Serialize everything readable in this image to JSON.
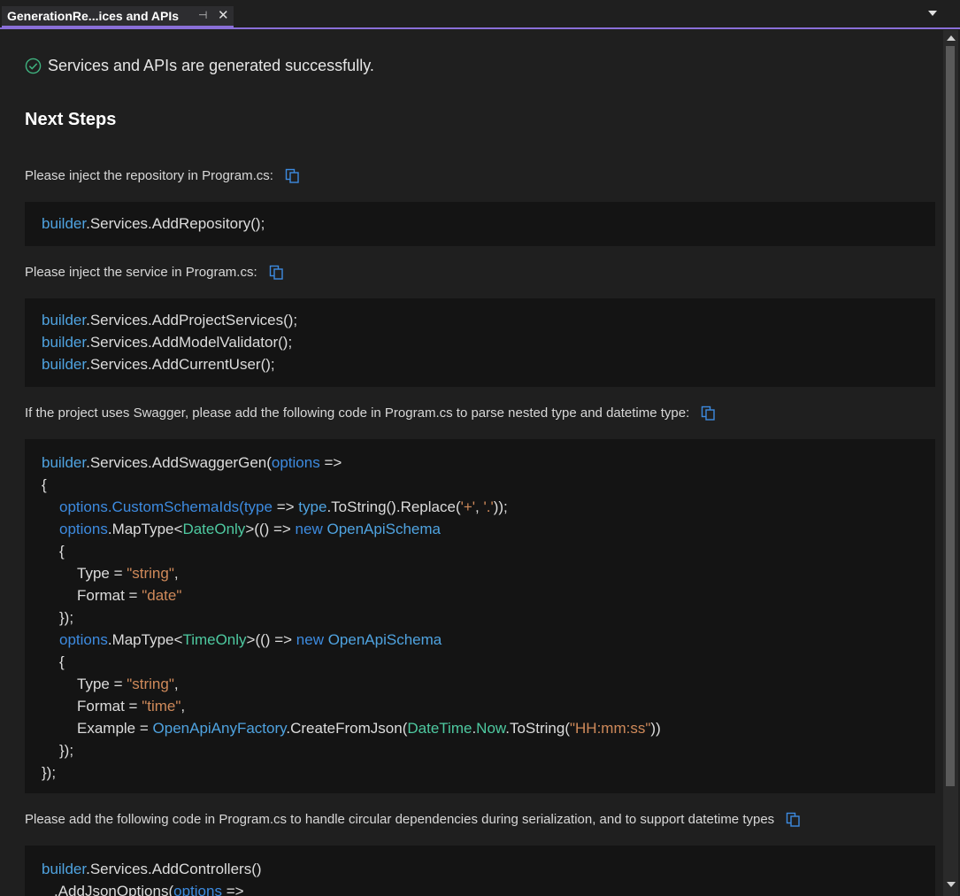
{
  "tab": {
    "title": "GenerationRe...ices and APIs",
    "pin_glyph": "⊣",
    "close_glyph": "✕"
  },
  "success_text": "Services and APIs are generated successfully.",
  "heading": "Next Steps",
  "steps": [
    {
      "text": "Please inject the repository in Program.cs:"
    },
    {
      "text": "Please inject the service in Program.cs:"
    },
    {
      "text": "If the project uses Swagger, please add the following code in Program.cs to parse nested type and datetime type:"
    },
    {
      "text": "Please add the following code in Program.cs to handle circular dependencies during serialization, and to support datetime types"
    }
  ],
  "code": {
    "builder": "builder",
    "options": "options",
    "type": "type",
    "services": ".Services.",
    "add_repository": "AddRepository();",
    "add_project_services": "AddProjectServices();",
    "add_model_validator": "AddModelValidator();",
    "add_current_user": "AddCurrentUser();",
    "add_swagger_gen": "AddSwaggerGen(",
    "arrow": " =>",
    "open_brace": "{",
    "custom_schema_ids": ".CustomSchemaIds(",
    "to_string_replace": ".ToString().Replace(",
    "plus_literal": "'+'",
    "comma": ", ",
    "dot_literal": "'.'",
    "close_call": "));",
    "map_type": "MapType",
    "lt": "<",
    "gt": ">",
    "date_only": "DateOnly",
    "time_only": "TimeOnly",
    "lambda_open": "(() => ",
    "new_kw": "new ",
    "open_api_schema": "OpenApiSchema",
    "type_eq": "Type = ",
    "string_literal": "\"string\"",
    "comma_end": ",",
    "format_eq": "Format = ",
    "date_literal": "\"date\"",
    "time_literal": "\"time\"",
    "close_obj": "});",
    "example_eq": "Example = ",
    "any_factory": "OpenApiAnyFactory",
    "create_from_json": ".CreateFromJson(",
    "datetime": "DateTime",
    "dot": ".",
    "now": "Now",
    "to_string": ".ToString(",
    "time_format": "\"HH:mm:ss\"",
    "close_paren": "))",
    "add_controllers": "AddControllers()",
    "add_json_options": ".AddJsonOptions("
  }
}
